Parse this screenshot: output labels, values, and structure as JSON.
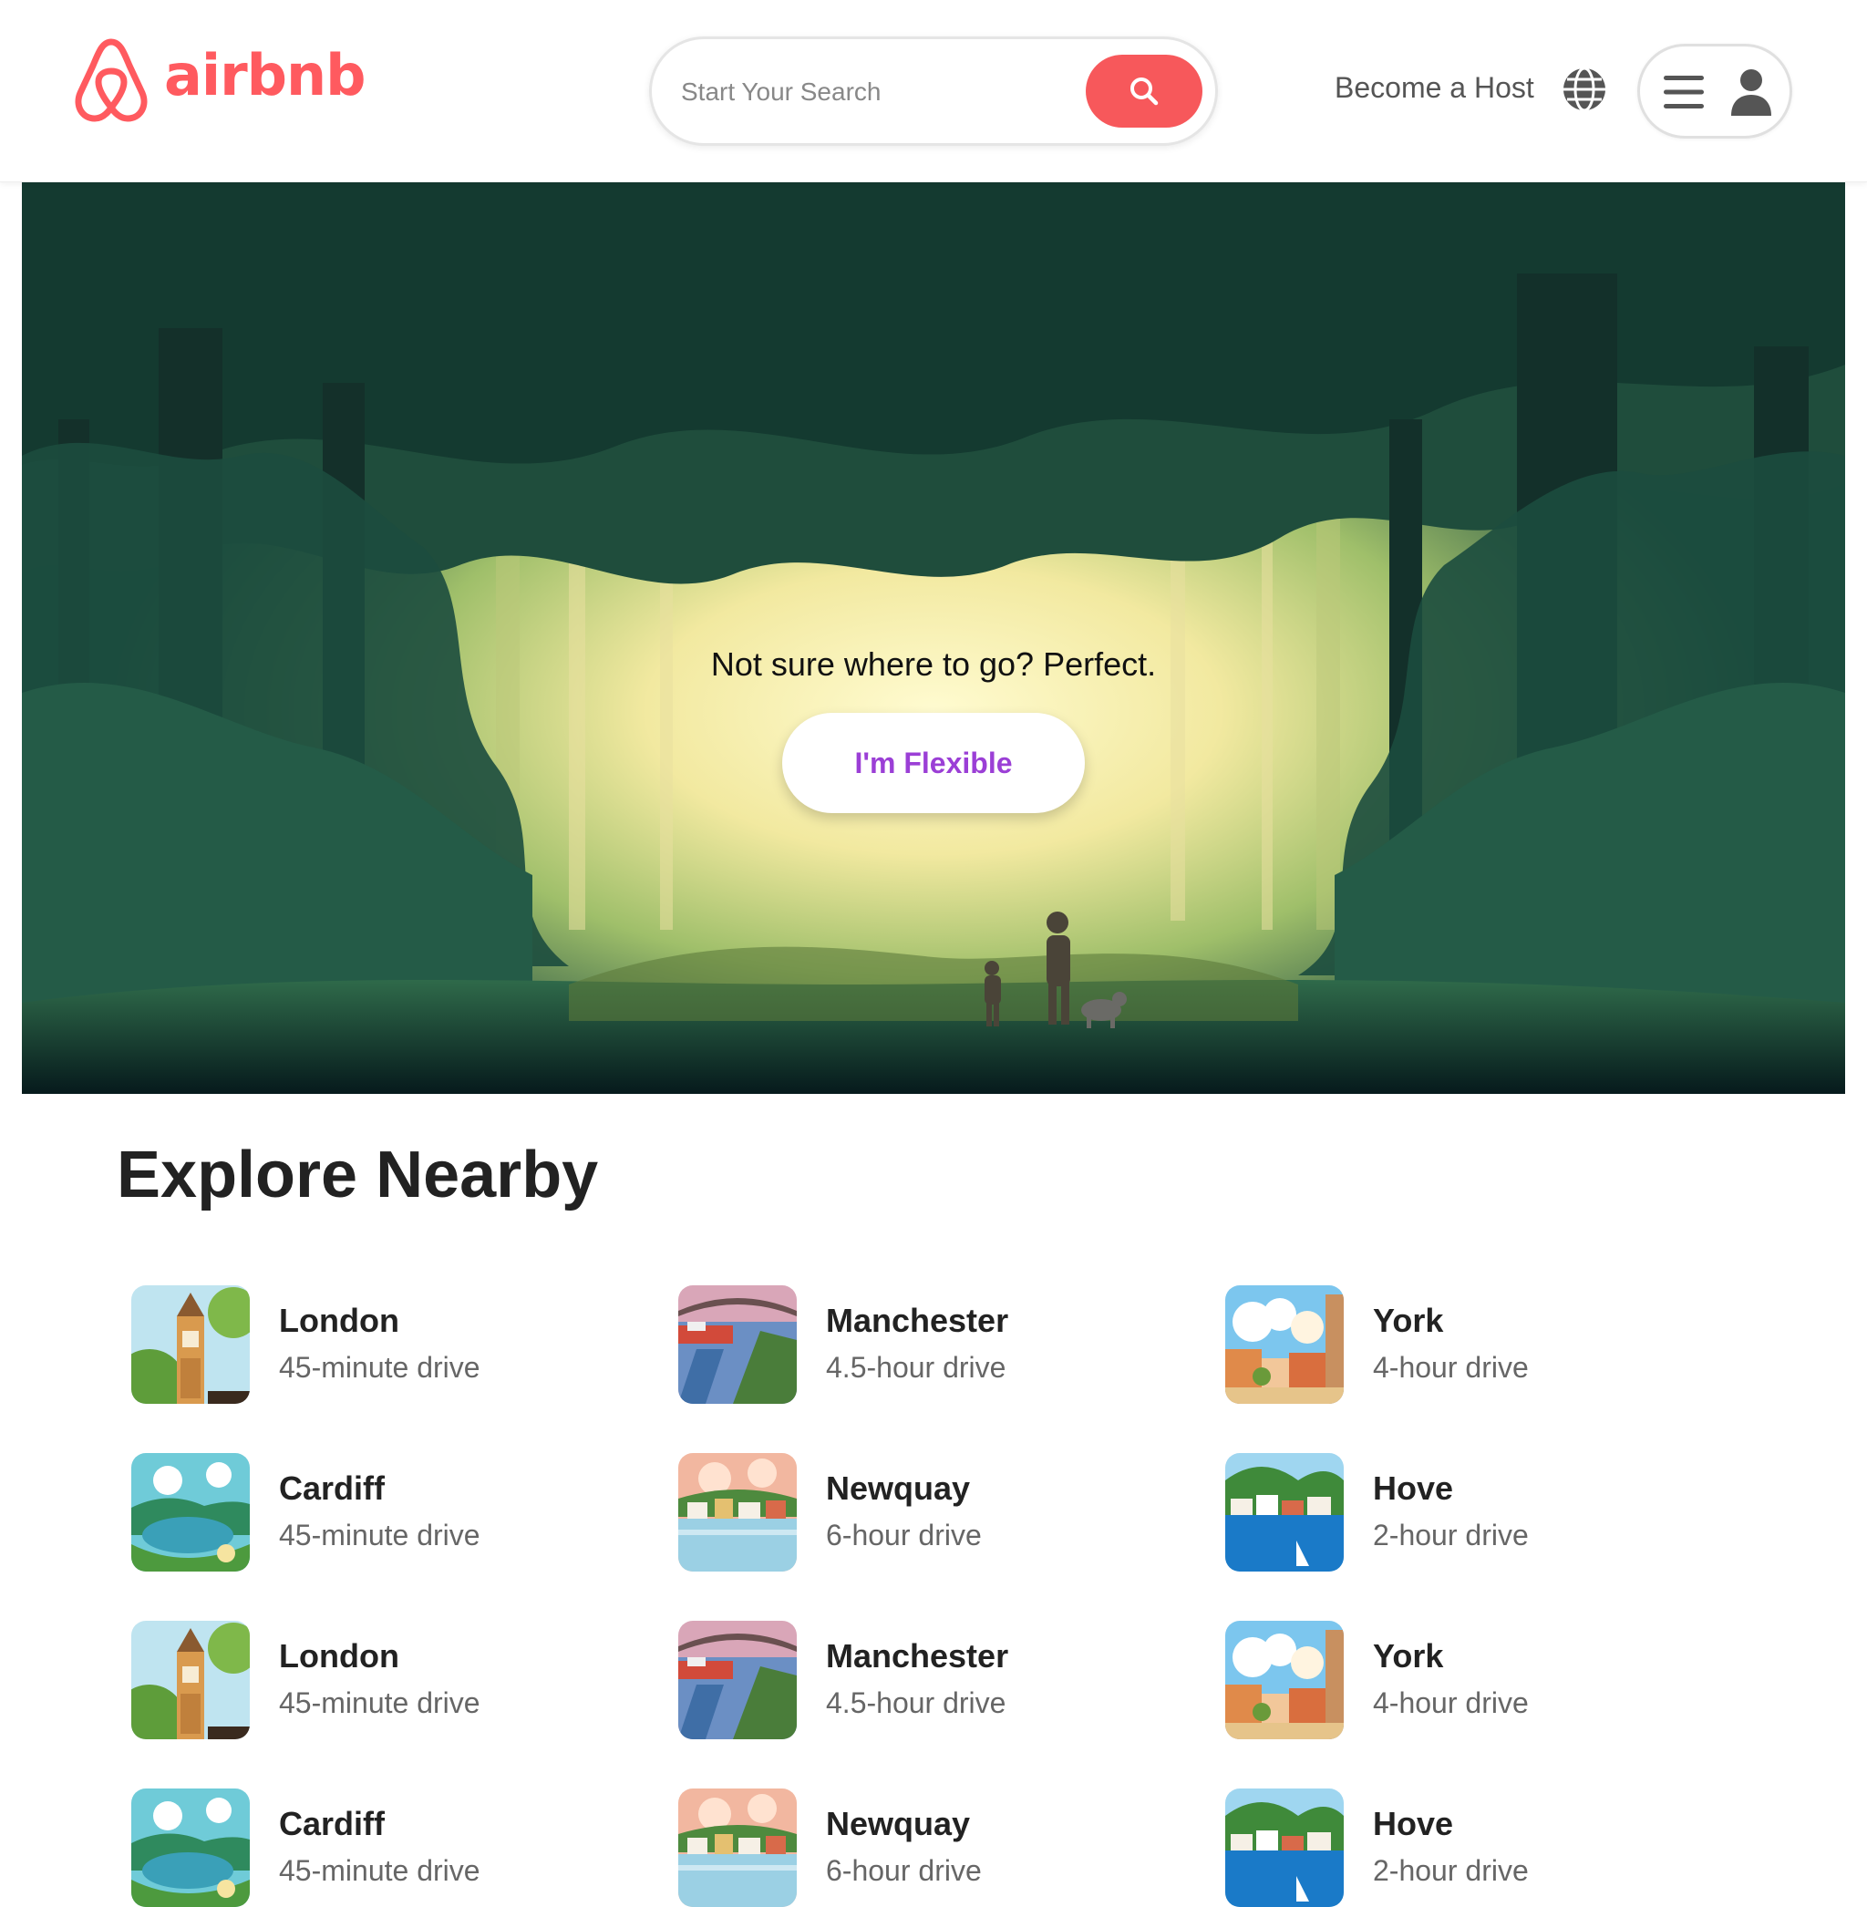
{
  "header": {
    "logo_text": "airbnb",
    "search": {
      "placeholder": "Start Your Search"
    },
    "host_label": "Become a Host",
    "brand_color": "#FF5A5F",
    "icons": [
      "airbnb-logo-icon",
      "search-icon",
      "globe-icon",
      "hamburger-icon",
      "user-icon"
    ]
  },
  "hero": {
    "tagline": "Not sure where to go? Perfect.",
    "button_label": "I'm Flexible",
    "button_color": "#9B3FD6"
  },
  "explore": {
    "title": "Explore Nearby",
    "items": [
      {
        "city": "London",
        "drive": "45-minute drive",
        "thumb": "london"
      },
      {
        "city": "Manchester",
        "drive": "4.5-hour drive",
        "thumb": "manchester"
      },
      {
        "city": "York",
        "drive": "4-hour drive",
        "thumb": "york"
      },
      {
        "city": "Cardiff",
        "drive": "45-minute drive",
        "thumb": "cardiff"
      },
      {
        "city": "Newquay",
        "drive": "6-hour drive",
        "thumb": "newquay"
      },
      {
        "city": "Hove",
        "drive": "2-hour drive",
        "thumb": "hove"
      },
      {
        "city": "London",
        "drive": "45-minute drive",
        "thumb": "london"
      },
      {
        "city": "Manchester",
        "drive": "4.5-hour drive",
        "thumb": "manchester"
      },
      {
        "city": "York",
        "drive": "4-hour drive",
        "thumb": "york"
      },
      {
        "city": "Cardiff",
        "drive": "45-minute drive",
        "thumb": "cardiff"
      },
      {
        "city": "Newquay",
        "drive": "6-hour drive",
        "thumb": "newquay"
      },
      {
        "city": "Hove",
        "drive": "2-hour drive",
        "thumb": "hove"
      }
    ]
  }
}
